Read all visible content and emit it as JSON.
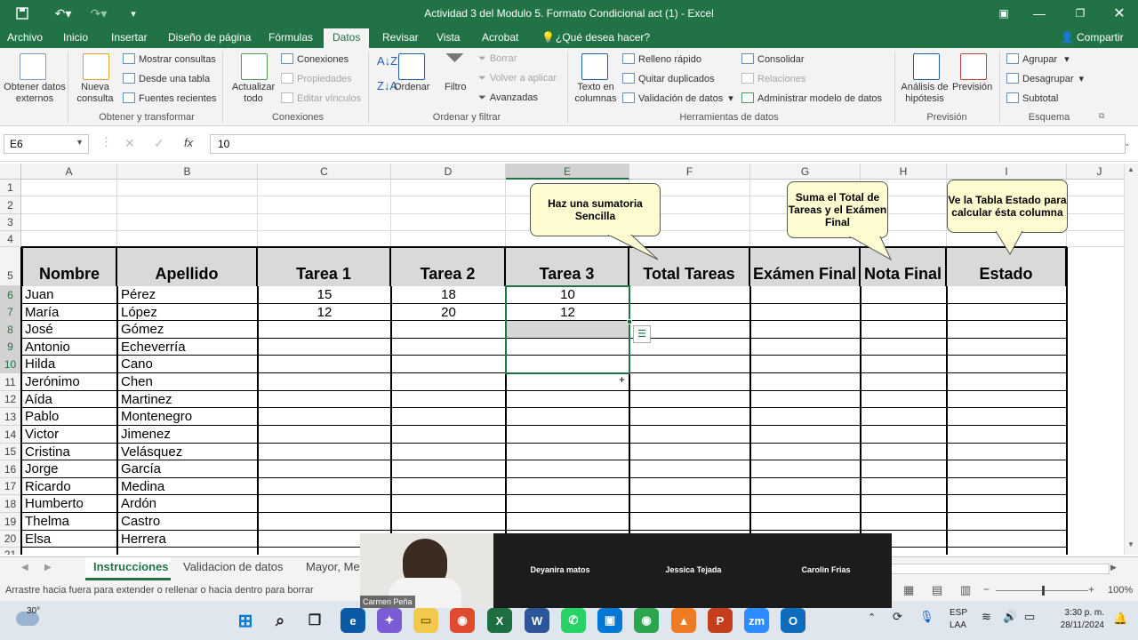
{
  "window": {
    "title": "Actividad 3 del Modulo 5. Formato Condicional act (1) - Excel"
  },
  "menu": {
    "tabs": [
      "Archivo",
      "Inicio",
      "Insertar",
      "Diseño de página",
      "Fórmulas",
      "Datos",
      "Revisar",
      "Vista",
      "Acrobat"
    ],
    "tell_me": "¿Qué desea hacer?",
    "share": "Compartir",
    "active": "Datos"
  },
  "ribbon": {
    "get_external": "Obtener datos externos",
    "new_query": "Nueva consulta",
    "show_queries": "Mostrar consultas",
    "from_table": "Desde una tabla",
    "recent_sources": "Fuentes recientes",
    "group_transform": "Obtener y transformar",
    "refresh_all": "Actualizar todo",
    "connections": "Conexiones",
    "properties": "Propiedades",
    "edit_links": "Editar vínculos",
    "group_connections": "Conexiones",
    "sort": "Ordenar",
    "filter": "Filtro",
    "clear": "Borrar",
    "reapply": "Volver a aplicar",
    "advanced": "Avanzadas",
    "group_sort": "Ordenar y filtrar",
    "text_to_columns": "Texto en columnas",
    "flash_fill": "Relleno rápido",
    "remove_duplicates": "Quitar duplicados",
    "data_validation": "Validación de datos",
    "consolidate": "Consolidar",
    "relationships": "Relaciones",
    "manage_model": "Administrar modelo de datos",
    "group_tools": "Herramientas de datos",
    "what_if": "Análisis de hipótesis",
    "forecast": "Previsión",
    "group_forecast": "Previsión",
    "group_outline_items": [
      "Agrupar",
      "Desagrupar",
      "Subtotal"
    ],
    "group_outline": "Esquema"
  },
  "formula_bar": {
    "name_box": "E6",
    "value": "10"
  },
  "columns": [
    "A",
    "B",
    "C",
    "D",
    "E",
    "F",
    "G",
    "H",
    "I",
    "J"
  ],
  "rows": [
    "1",
    "2",
    "3",
    "4",
    "5",
    "6",
    "7",
    "8",
    "9",
    "10",
    "11",
    "12",
    "13",
    "14",
    "15",
    "16",
    "17",
    "18",
    "19",
    "20",
    "21"
  ],
  "headers": [
    "Nombre",
    "Apellido",
    "Tarea 1",
    "Tarea 2",
    "Tarea 3",
    "Total Tareas",
    "Exámen Final",
    "Nota Final",
    "Estado"
  ],
  "students": [
    {
      "nombre": "Juan",
      "apellido": "Pérez",
      "t1": "15",
      "t2": "18",
      "t3": "10"
    },
    {
      "nombre": "María",
      "apellido": "López",
      "t1": "12",
      "t2": "20",
      "t3": "12"
    },
    {
      "nombre": "José",
      "apellido": "Gómez"
    },
    {
      "nombre": "Antonio",
      "apellido": "Echeverría"
    },
    {
      "nombre": "Hilda",
      "apellido": "Cano"
    },
    {
      "nombre": "Jerónimo",
      "apellido": "Chen"
    },
    {
      "nombre": "Aída",
      "apellido": "Martinez"
    },
    {
      "nombre": "Pablo",
      "apellido": "Montenegro"
    },
    {
      "nombre": "Victor",
      "apellido": "Jimenez"
    },
    {
      "nombre": "Cristina",
      "apellido": "Velásquez"
    },
    {
      "nombre": "Jorge",
      "apellido": "García"
    },
    {
      "nombre": "Ricardo",
      "apellido": "Medina"
    },
    {
      "nombre": "Humberto",
      "apellido": "Ardón"
    },
    {
      "nombre": "Thelma",
      "apellido": "Castro"
    },
    {
      "nombre": "Elsa",
      "apellido": "Herrera"
    }
  ],
  "callouts": {
    "sum": "Haz una sumatoria Sencilla",
    "total": "Suma el Total de Tareas y el Exámen Final",
    "estado": "Ve la Tabla Estado para calcular ésta columna"
  },
  "sheets": [
    "Instrucciones",
    "Validacion de datos",
    "Mayor, Me"
  ],
  "status": {
    "message": "Arrastre hacia fuera para extender o rellenar o hacia dentro para borrar",
    "zoom": "100%"
  },
  "video": {
    "participants": [
      "Carmen Peña",
      "Deyanira matos",
      "Jessica Tejada",
      "Carolin Frias"
    ]
  },
  "taskbar": {
    "weather": "30°",
    "lang1": "ESP",
    "lang2": "LAA",
    "time": "3:30 p. m.",
    "date": "28/11/2024"
  },
  "colors": {
    "excel_green": "#217346",
    "header_fill": "#d9d9d9",
    "callout": "#fffbd1",
    "selection": "#217346"
  }
}
